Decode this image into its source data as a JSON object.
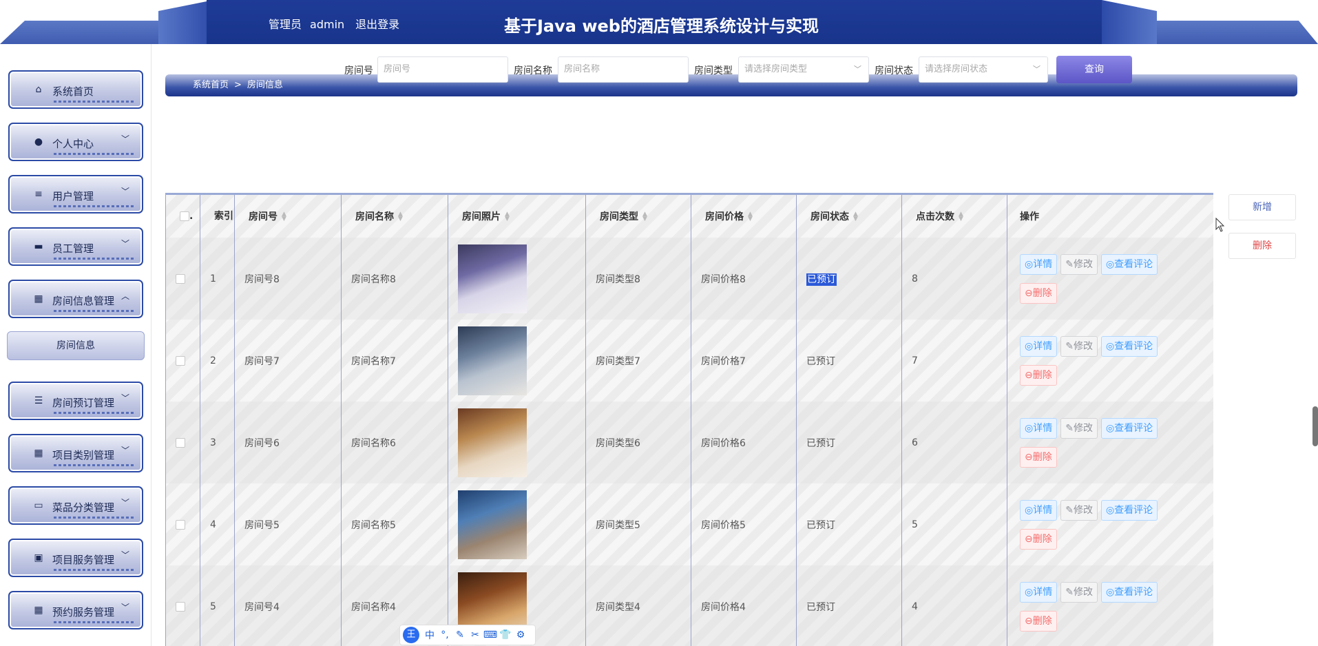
{
  "header": {
    "role": "管理员",
    "username": "admin",
    "logout": "退出登录",
    "title": "基于Java web的酒店管理系统设计与实现"
  },
  "sidebar": {
    "items": [
      {
        "label": "系统首页",
        "icon": "home-icon",
        "glyph": "⌂",
        "chevron": ""
      },
      {
        "label": "个人中心",
        "icon": "user-icon",
        "glyph": "●",
        "chevron": "﹀"
      },
      {
        "label": "用户管理",
        "icon": "list-icon",
        "glyph": "≡",
        "chevron": "﹀"
      },
      {
        "label": "员工管理",
        "icon": "printer-icon",
        "glyph": "▬",
        "chevron": "﹀"
      },
      {
        "label": "房间信息管理",
        "icon": "grid-icon",
        "glyph": "▦",
        "chevron": "︿"
      },
      {
        "label": "房间预订管理",
        "icon": "list-icon",
        "glyph": "☰",
        "chevron": "﹀"
      },
      {
        "label": "项目类别管理",
        "icon": "grid-icon",
        "glyph": "▦",
        "chevron": "﹀"
      },
      {
        "label": "菜品分类管理",
        "icon": "monitor-icon",
        "glyph": "▭",
        "chevron": "﹀"
      },
      {
        "label": "项目服务管理",
        "icon": "box-icon",
        "glyph": "▣",
        "chevron": "﹀"
      },
      {
        "label": "预约服务管理",
        "icon": "grid-icon",
        "glyph": "▦",
        "chevron": "﹀"
      }
    ],
    "sub_item": "房间信息"
  },
  "breadcrumb": [
    "系统首页",
    ">",
    "房间信息"
  ],
  "search": {
    "room_no_label": "房间号",
    "room_no_placeholder": "房间号",
    "room_name_label": "房间名称",
    "room_name_placeholder": "房间名称",
    "room_type_label": "房间类型",
    "room_type_placeholder": "请选择房间类型",
    "room_status_label": "房间状态",
    "room_status_placeholder": "请选择房间状态",
    "query_button": "查询"
  },
  "actions": {
    "add": "新增",
    "delete": "删除"
  },
  "table": {
    "headers": {
      "select": ".",
      "index": "索引",
      "room_no": "房间号",
      "room_name": "房间名称",
      "photo": "房间照片",
      "type": "房间类型",
      "price": "房间价格",
      "status": "房间状态",
      "clicks": "点击次数",
      "ops": "操作"
    },
    "op_labels": {
      "detail": "◎详情",
      "edit": "✎修改",
      "comments": "◎查看评论",
      "delete": "⊖删除"
    },
    "rows": [
      {
        "index": "1",
        "room_no": "房间号8",
        "room_name": "房间名称8",
        "type": "房间类型8",
        "price": "房间价格8",
        "status": "已预订",
        "clicks": "8"
      },
      {
        "index": "2",
        "room_no": "房间号7",
        "room_name": "房间名称7",
        "type": "房间类型7",
        "price": "房间价格7",
        "status": "已预订",
        "clicks": "7"
      },
      {
        "index": "3",
        "room_no": "房间号6",
        "room_name": "房间名称6",
        "type": "房间类型6",
        "price": "房间价格6",
        "status": "已预订",
        "clicks": "6"
      },
      {
        "index": "4",
        "room_no": "房间号5",
        "room_name": "房间名称5",
        "type": "房间类型5",
        "price": "房间价格5",
        "status": "已预订",
        "clicks": "5"
      },
      {
        "index": "5",
        "room_no": "房间号4",
        "room_name": "房间名称4",
        "type": "房间类型4",
        "price": "房间价格4",
        "status": "已预订",
        "clicks": "4"
      }
    ]
  },
  "ime": {
    "logo": "王",
    "items": [
      "中",
      "°,",
      "✎",
      "✂",
      "⌨",
      "👕",
      "⚙"
    ]
  },
  "colors": {
    "header": "#1e3b97",
    "nav_border": "#2b4aa6",
    "query_button": "#6b66d4",
    "add": "#4a63b8",
    "delete": "#e04848"
  }
}
